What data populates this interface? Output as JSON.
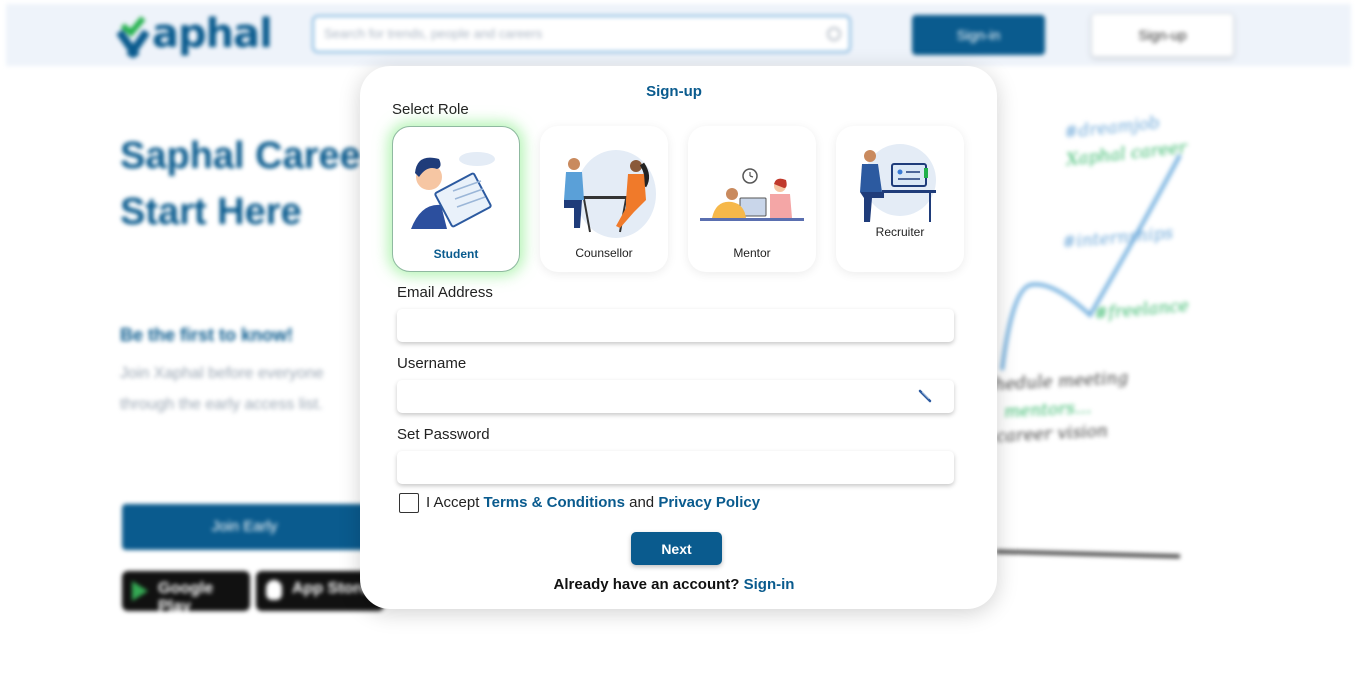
{
  "header": {
    "logo_text": "aphal",
    "search_placeholder": "Search for trends, people and careers",
    "signin_label": "Sign-in",
    "signup_label": "Sign-up"
  },
  "hero": {
    "line1": "Saphal Caree",
    "line2": "Start Here",
    "subheading": "Be the first to know!",
    "text_line1": "Join Xaphal before everyone",
    "text_line2": "through the early access list.",
    "join_label": "Join Early",
    "google_play": "Google Play",
    "app_store": "App Store"
  },
  "background_notes": {
    "note1": "#dreamjob",
    "note2": "Xaphal career",
    "note3": "#internships",
    "note4": "#freelance",
    "note5": "schedule meeting",
    "note6": "mentors...",
    "note7": "career vision"
  },
  "modal": {
    "title": "Sign-up",
    "select_role_label": "Select Role",
    "roles": [
      {
        "label": "Student",
        "selected": true
      },
      {
        "label": "Counsellor",
        "selected": false
      },
      {
        "label": "Mentor",
        "selected": false
      },
      {
        "label": "Recruiter",
        "selected": false
      }
    ],
    "email_label": "Email Address",
    "email_value": "",
    "username_label": "Username",
    "username_value": "",
    "password_label": "Set Password",
    "password_value": "",
    "terms_prefix": "I Accept ",
    "terms_link": "Terms & Conditions",
    "terms_and": " and ",
    "privacy_link": "Privacy Policy",
    "next_label": "Next",
    "already_text": "Already have an account? ",
    "signin_link": "Sign-in"
  },
  "colors": {
    "brand_blue": "#0a5b8e",
    "brand_green": "#22b14c",
    "selected_glow": "#78eb78"
  },
  "icons": [
    "search-icon",
    "pencil-icon",
    "checkmark-logo-icon",
    "google-play-icon",
    "apple-icon"
  ]
}
